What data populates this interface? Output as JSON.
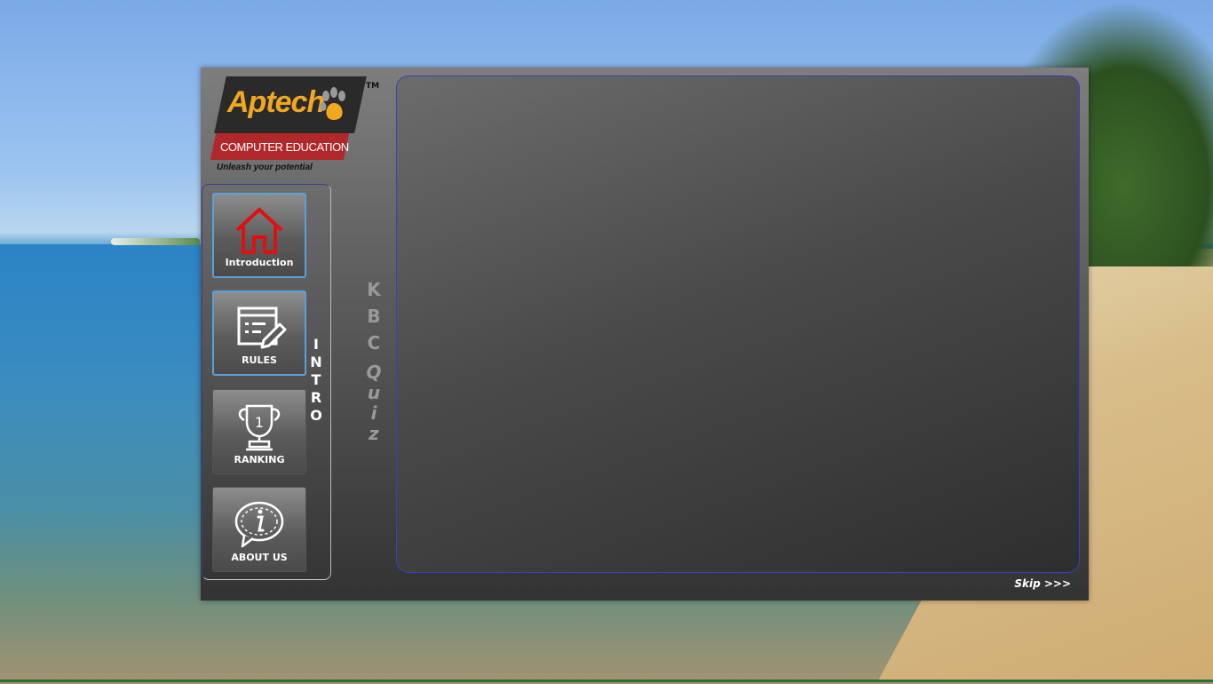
{
  "logo": {
    "title": "Aptech",
    "subtitle": "COMPUTER EDUCATION",
    "tagline": "Unleash your potential",
    "trademark": "TM"
  },
  "nav": {
    "items": [
      {
        "label": "Introduction",
        "icon": "home-icon",
        "active": true
      },
      {
        "label": "RULES",
        "icon": "rules-edit-icon",
        "active": false
      },
      {
        "label": "RANKING",
        "icon": "trophy-icon",
        "active": false
      },
      {
        "label": "ABOUT US",
        "icon": "info-chat-icon",
        "active": false
      }
    ]
  },
  "section_label": "INTRO",
  "brand_vertical": {
    "kbc": "KBC",
    "quiz": "Quiz"
  },
  "skip_label": "Skip >>>",
  "colors": {
    "home_icon": "#e01010",
    "content_border": "#3b3fbb",
    "active_border": "#5aa0dd",
    "logo_orange": "#f1a81f",
    "logo_red": "#b1282b"
  }
}
